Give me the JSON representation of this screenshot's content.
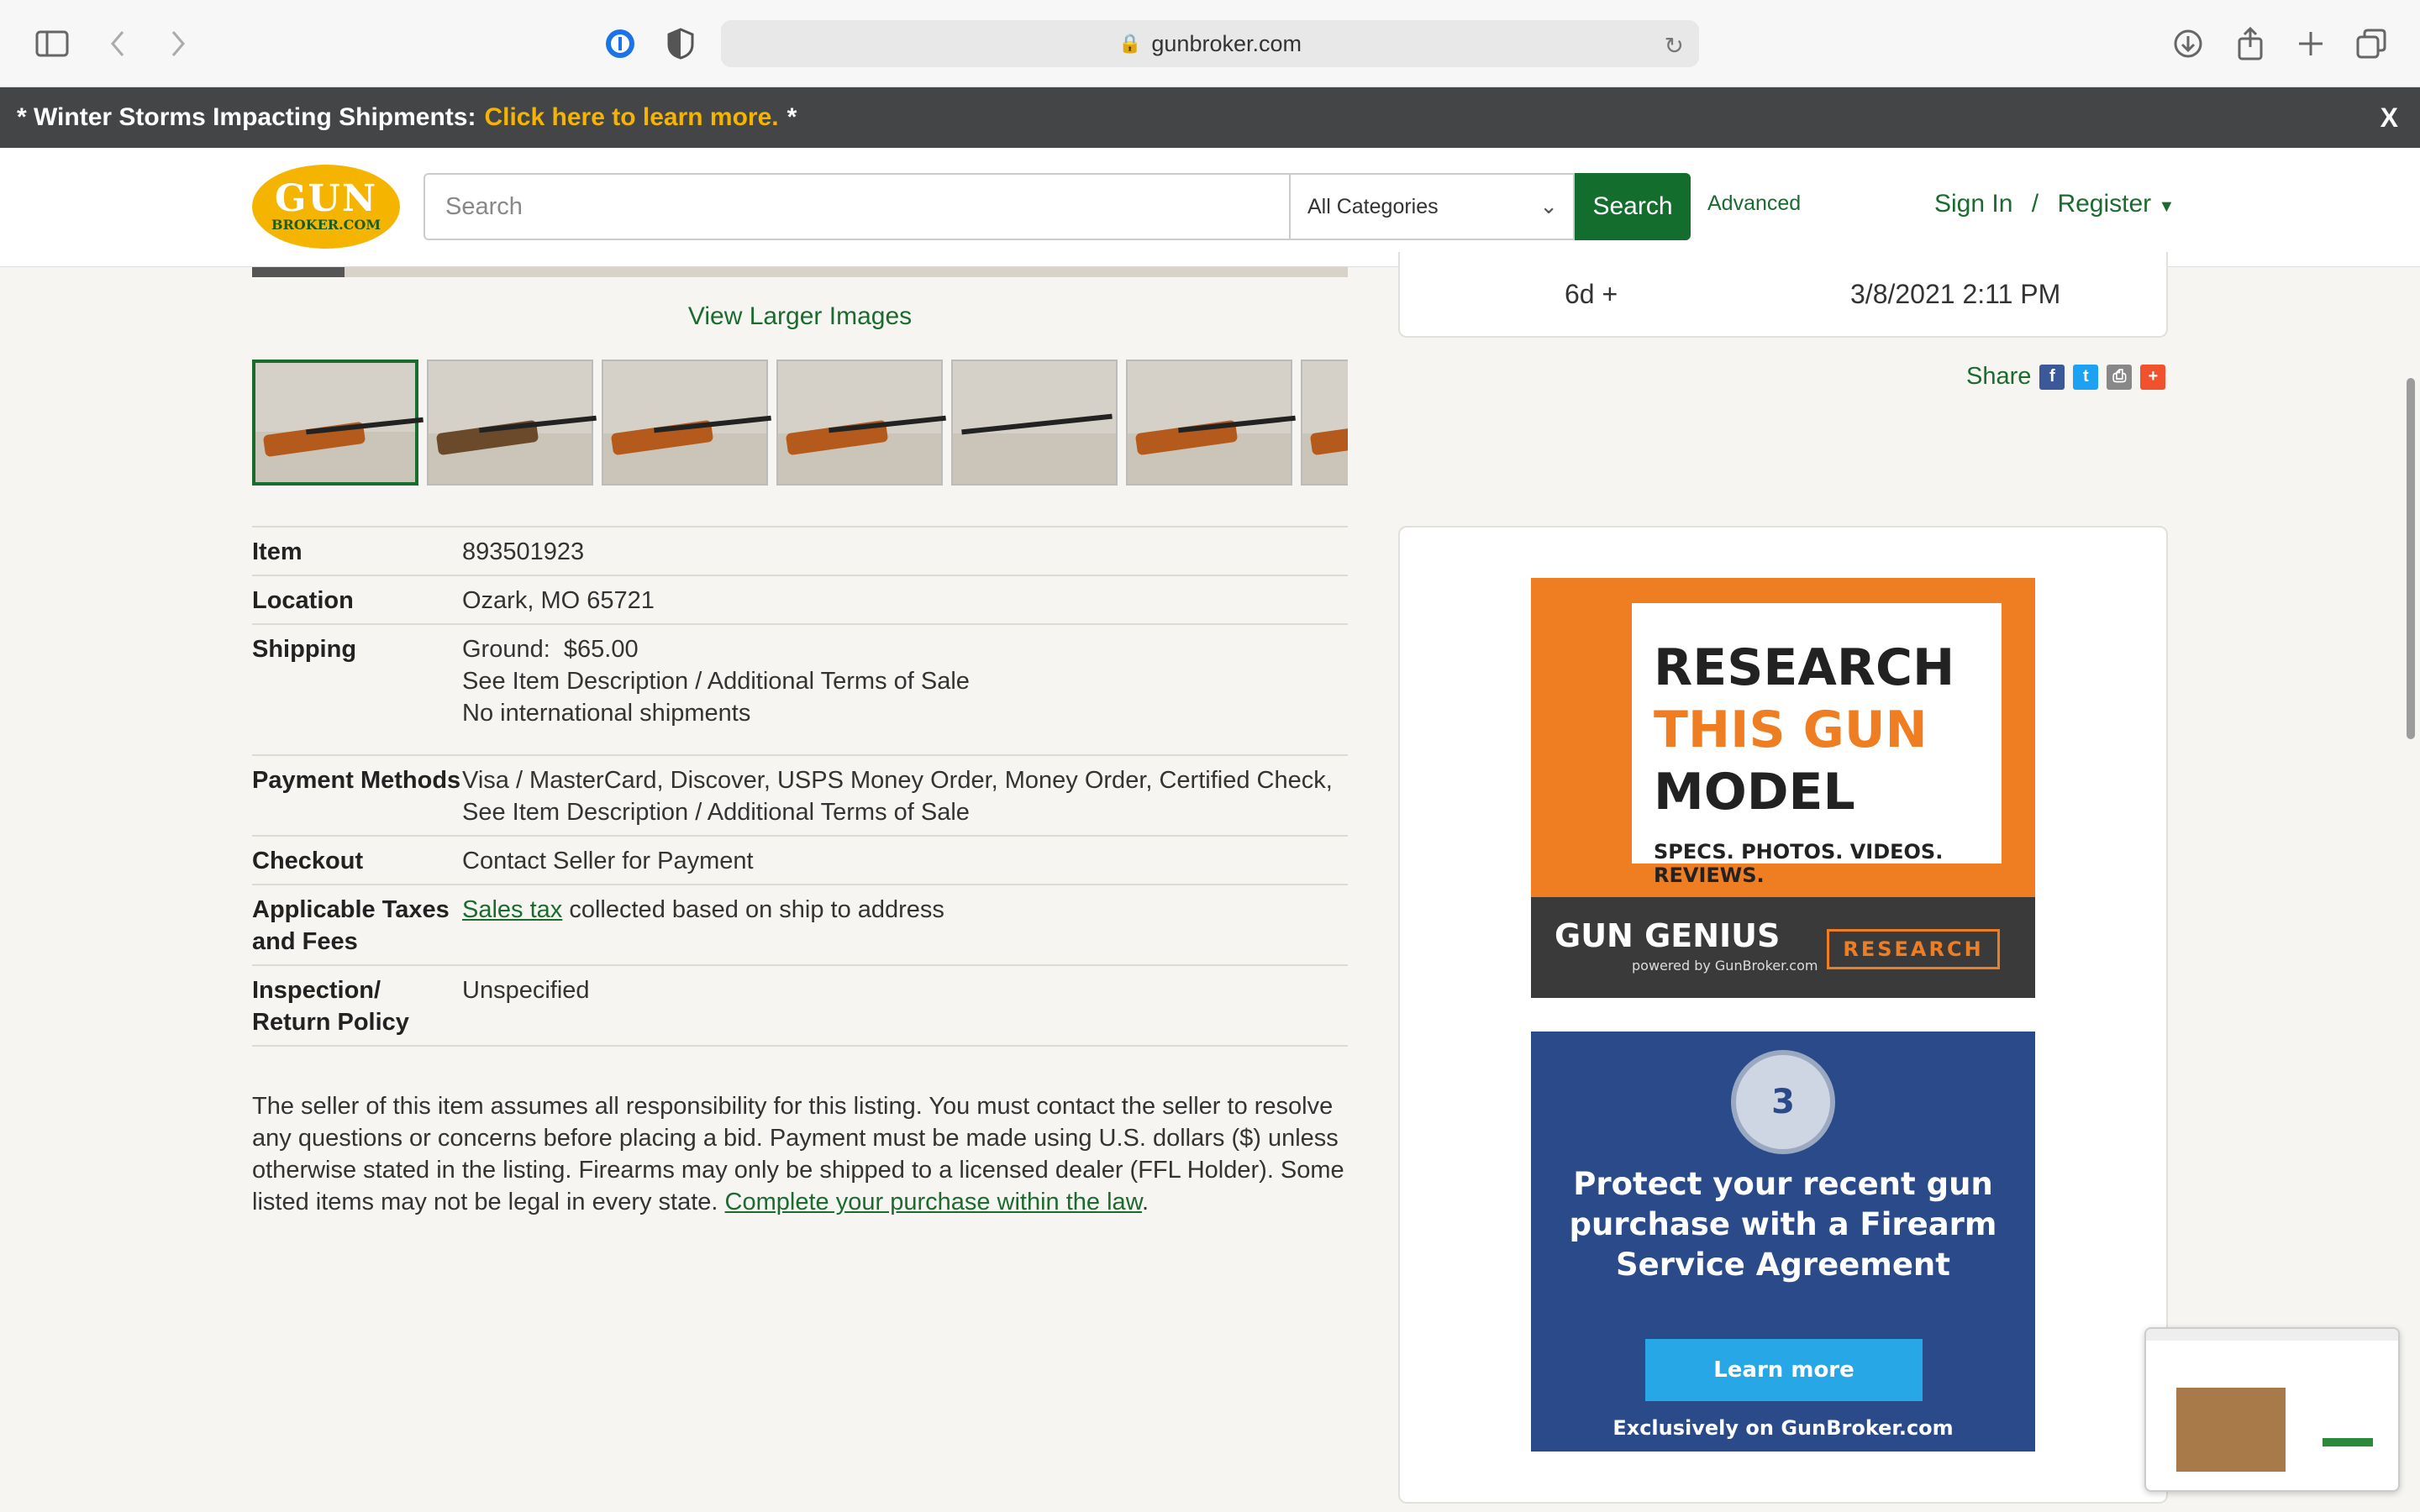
{
  "browser": {
    "url": "gunbroker.com"
  },
  "notice": {
    "text": "* Winter Storms Impacting Shipments:",
    "link": "Click here to learn more.",
    "suffix": "*",
    "close": "X"
  },
  "header": {
    "logo_top": "GUN",
    "logo_bottom": "BROKER.COM",
    "search_placeholder": "Search",
    "category": "All Categories",
    "search_button": "Search",
    "advanced": "Advanced",
    "signin": "Sign In",
    "divider": "/",
    "register": "Register"
  },
  "listing": {
    "view_larger": "View Larger Images",
    "time_left": "6d +",
    "end_date": "3/8/2021 2:11 PM",
    "share_label": "Share",
    "details": [
      {
        "label": "Item",
        "value": "893501923"
      },
      {
        "label": "Location",
        "value": "Ozark, MO 65721"
      },
      {
        "label": "Shipping",
        "lines": [
          "Ground:  $65.00",
          "See Item Description / Additional Terms of Sale",
          "No international shipments"
        ]
      },
      {
        "label": "Payment Methods",
        "lines": [
          "Visa / MasterCard, Discover, USPS Money Order, Money Order, Certified Check,",
          "See Item Description / Additional Terms of Sale"
        ]
      },
      {
        "label": "Checkout",
        "value": "Contact Seller for Payment"
      },
      {
        "label": "Applicable Taxes and Fees",
        "link": "Sales tax",
        "value": "collected based on ship to address"
      },
      {
        "label": "Inspection/ Return Policy",
        "value": "Unspecified"
      }
    ],
    "disclaimer": "The seller of this item assumes all responsibility for this listing. You must contact the seller to resolve any questions or concerns before placing a bid. Payment must be made using U.S. dollars ($) unless otherwise stated in the listing. Firearms may only be shipped to a licensed dealer (FFL Holder). Some listed items may not be legal in every state.",
    "disclaimer_link": "Complete your purchase within the law",
    "disclaimer_end": "."
  },
  "ads": {
    "ad1": {
      "line1": "RESEARCH",
      "line2": "THIS GUN",
      "line3": "MODEL",
      "sub": "SPECS. PHOTOS. VIDEOS. REVIEWS.",
      "brand": "GUN GENIUS",
      "brand_sub": "powered by GunBroker.com",
      "button": "RESEARCH"
    },
    "ad2": {
      "badge": "3",
      "message": "Protect your recent gun purchase with a Firearm Service Agreement",
      "button": "Learn more",
      "footer": "Exclusively on GunBroker.com"
    }
  },
  "colors": {
    "brand_green": "#136d2d",
    "link_green": "#1b6b2f",
    "accent_yellow": "#f5b400",
    "ad_orange": "#ef7d22",
    "ad_blue": "#2a4a8a"
  }
}
